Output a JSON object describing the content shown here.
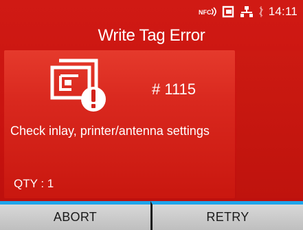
{
  "status_bar": {
    "icons": [
      "nfc-icon",
      "sd-card-icon",
      "network-icon",
      "bluetooth-icon"
    ],
    "time": "14:11"
  },
  "title": "Write Tag Error",
  "error": {
    "icon": "rfid-tag-error-icon",
    "code": "# 1115",
    "message": "Check inlay, printer/antenna settings",
    "qty": "QTY : 1"
  },
  "buttons": {
    "abort_label": "ABORT",
    "retry_label": "RETRY"
  },
  "colors": {
    "background": "#c8120f",
    "button_accent": "#1fa4ea"
  }
}
